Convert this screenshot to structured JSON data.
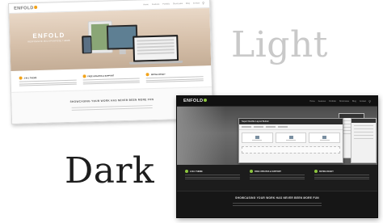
{
  "labels": {
    "light": "Light",
    "dark": "Dark"
  },
  "light_theme": {
    "logo": "ENFOLD",
    "nav_items": [
      "Home",
      "Features",
      "Portfolio",
      "Shortcodes",
      "Blog",
      "Contact"
    ],
    "hero_title": "ENFOLD",
    "hero_subtitle": "RESPONSIVE MULTIPURPOSE THEME",
    "features": [
      {
        "title": "2-IN-1 THEME"
      },
      {
        "title": "FREE UPDATES & SUPPORT"
      },
      {
        "title": "RETINA READY"
      }
    ],
    "showcase_title": "SHOWCASING YOUR WORK HAS NEVER BEEN MORE FUN",
    "accent": "#f2a31a"
  },
  "dark_theme": {
    "logo": "ENFOLD",
    "nav_items": [
      "Home",
      "Features",
      "Portfolio",
      "Shortcodes",
      "Blog",
      "Contact"
    ],
    "builder_label": "Super Flexible Layout Builder",
    "features": [
      {
        "title": "2-IN-1 THEME"
      },
      {
        "title": "FREE UPDATES & SUPPORT"
      },
      {
        "title": "RETINA READY"
      }
    ],
    "showcase_title": "SHOWCASING YOUR WORK HAS NEVER BEEN MORE FUN",
    "accent": "#8dc63f"
  },
  "icons": {
    "search": "search-icon",
    "feature": "circle-icon"
  }
}
